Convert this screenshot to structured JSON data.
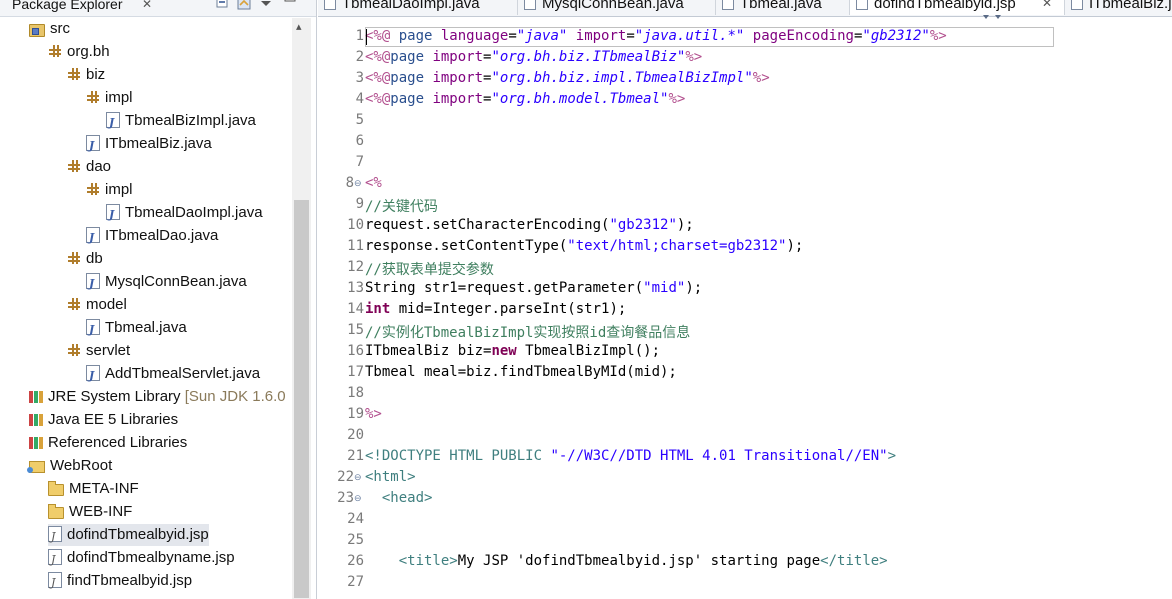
{
  "package_explorer": {
    "title": "Package Explorer",
    "close_glyph": "✕",
    "scroll_up_glyph": "▴",
    "tree": [
      {
        "label": "src",
        "icon": "source-folder-icon",
        "indent": 0
      },
      {
        "label": "org.bh",
        "icon": "package-icon",
        "indent": 1
      },
      {
        "label": "biz",
        "icon": "package-icon",
        "indent": 2
      },
      {
        "label": "impl",
        "icon": "package-icon",
        "indent": 3
      },
      {
        "label": "TbmealBizImpl.java",
        "icon": "java-file-icon",
        "indent": 4
      },
      {
        "label": "ITbmealBiz.java",
        "icon": "java-file-icon",
        "indent": 3
      },
      {
        "label": "dao",
        "icon": "package-icon",
        "indent": 2
      },
      {
        "label": "impl",
        "icon": "package-icon",
        "indent": 3
      },
      {
        "label": "TbmealDaoImpl.java",
        "icon": "java-file-icon",
        "indent": 4
      },
      {
        "label": "ITbmealDao.java",
        "icon": "java-file-icon",
        "indent": 3
      },
      {
        "label": "db",
        "icon": "package-icon",
        "indent": 2
      },
      {
        "label": "MysqlConnBean.java",
        "icon": "java-file-icon",
        "indent": 3
      },
      {
        "label": "model",
        "icon": "package-icon",
        "indent": 2
      },
      {
        "label": "Tbmeal.java",
        "icon": "java-file-icon",
        "indent": 3
      },
      {
        "label": "servlet",
        "icon": "package-icon",
        "indent": 2
      },
      {
        "label": "AddTbmealServlet.java",
        "icon": "java-file-icon",
        "indent": 3
      },
      {
        "label": "JRE System Library",
        "decoration": "[Sun JDK 1.6.0",
        "icon": "library-icon",
        "indent": 0
      },
      {
        "label": "Java EE 5 Libraries",
        "icon": "library-icon",
        "indent": 0
      },
      {
        "label": "Referenced Libraries",
        "icon": "library-icon",
        "indent": 0
      },
      {
        "label": "WebRoot",
        "icon": "web-root-folder-icon",
        "indent": 0
      },
      {
        "label": "META-INF",
        "icon": "folder-icon",
        "indent": 1
      },
      {
        "label": "WEB-INF",
        "icon": "folder-icon",
        "indent": 1
      },
      {
        "label": "dofindTbmealbyid.jsp",
        "icon": "jsp-file-icon",
        "indent": 1,
        "selected": true
      },
      {
        "label": "dofindTbmealbyname.jsp",
        "icon": "jsp-file-icon",
        "indent": 1
      },
      {
        "label": "findTbmealbyid.jsp",
        "icon": "jsp-file-icon",
        "indent": 1
      }
    ]
  },
  "editor": {
    "tabs": [
      {
        "label": "TbmealDaoImpl.java",
        "active": false
      },
      {
        "label": "MysqlConnBean.java",
        "active": false
      },
      {
        "label": "Tbmeal.java",
        "active": false
      },
      {
        "label": "dofindTbmealbyid.jsp",
        "active": true,
        "close_glyph": "✕"
      },
      {
        "label": "ITbmealBiz.java",
        "active": false
      }
    ],
    "fold_glyph": "⊖",
    "lines": [
      {
        "n": "1",
        "tokens": [
          [
            "tag",
            "<%@ "
          ],
          [
            "kw",
            "page "
          ],
          [
            "attr",
            "language"
          ],
          [
            "",
            "="
          ],
          [
            "str-i",
            "\"java\""
          ],
          [
            "",
            " "
          ],
          [
            "attr",
            "import"
          ],
          [
            "",
            "="
          ],
          [
            "str-i",
            "\"java.util.*\""
          ],
          [
            "",
            " "
          ],
          [
            "attr",
            "pageEncoding"
          ],
          [
            "",
            "="
          ],
          [
            "str-i",
            "\"gb2312\""
          ],
          [
            "tag",
            "%>"
          ]
        ]
      },
      {
        "n": "2",
        "tokens": [
          [
            "tag",
            "<%@"
          ],
          [
            "kw",
            "page "
          ],
          [
            "attr",
            "import"
          ],
          [
            "",
            "="
          ],
          [
            "str-i",
            "\"org.bh.biz.ITbmealBiz\""
          ],
          [
            "tag",
            "%>"
          ]
        ]
      },
      {
        "n": "3",
        "tokens": [
          [
            "tag",
            "<%@"
          ],
          [
            "kw",
            "page "
          ],
          [
            "attr",
            "import"
          ],
          [
            "",
            "="
          ],
          [
            "str-i",
            "\"org.bh.biz.impl.TbmealBizImpl\""
          ],
          [
            "tag",
            "%>"
          ]
        ]
      },
      {
        "n": "4",
        "tokens": [
          [
            "tag",
            "<%@"
          ],
          [
            "kw",
            "page "
          ],
          [
            "attr",
            "import"
          ],
          [
            "",
            "="
          ],
          [
            "str-i",
            "\"org.bh.model.Tbmeal\""
          ],
          [
            "tag",
            "%>"
          ]
        ]
      },
      {
        "n": "5",
        "tokens": []
      },
      {
        "n": "6",
        "tokens": []
      },
      {
        "n": "7",
        "tokens": []
      },
      {
        "n": "8",
        "fold": true,
        "tokens": [
          [
            "tag",
            "<%"
          ]
        ]
      },
      {
        "n": "9",
        "tokens": [
          [
            "cm",
            "//关键代码"
          ]
        ]
      },
      {
        "n": "10",
        "tokens": [
          [
            "",
            "request.setCharacterEncoding("
          ],
          [
            "str",
            "\"gb2312\""
          ],
          [
            "",
            ");"
          ]
        ]
      },
      {
        "n": "11",
        "tokens": [
          [
            "",
            "response.setContentType("
          ],
          [
            "str",
            "\"text/html;charset=gb2312\""
          ],
          [
            "",
            ");"
          ]
        ]
      },
      {
        "n": "12",
        "tokens": [
          [
            "cm",
            "//获取表单提交参数"
          ]
        ]
      },
      {
        "n": "13",
        "tokens": [
          [
            "",
            "String str1=request.getParameter("
          ],
          [
            "str",
            "\"mid\""
          ],
          [
            "",
            ");"
          ]
        ]
      },
      {
        "n": "14",
        "tokens": [
          [
            "jkw",
            "int"
          ],
          [
            "",
            " mid=Integer.parseInt(str1);"
          ]
        ]
      },
      {
        "n": "15",
        "tokens": [
          [
            "cm",
            "//实例化TbmealBizImpl实现按照id查询餐品信息"
          ]
        ]
      },
      {
        "n": "16",
        "tokens": [
          [
            "",
            "ITbmealBiz biz="
          ],
          [
            "jkw",
            "new"
          ],
          [
            "",
            " TbmealBizImpl();"
          ]
        ]
      },
      {
        "n": "17",
        "tokens": [
          [
            "",
            "Tbmeal meal=biz.findTbmealByMId(mid);"
          ]
        ]
      },
      {
        "n": "18",
        "tokens": []
      },
      {
        "n": "19",
        "tokens": [
          [
            "tag",
            "%>"
          ]
        ]
      },
      {
        "n": "20",
        "tokens": []
      },
      {
        "n": "21",
        "tokens": [
          [
            "html",
            "<!DOCTYPE HTML PUBLIC "
          ],
          [
            "dstr",
            "\"-//W3C//DTD HTML 4.01 Transitional//EN\""
          ],
          [
            "html",
            ">"
          ]
        ]
      },
      {
        "n": "22",
        "fold": true,
        "tokens": [
          [
            "html",
            "<html>"
          ]
        ]
      },
      {
        "n": "23",
        "fold": true,
        "tokens": [
          [
            "",
            "  "
          ],
          [
            "html",
            "<head>"
          ]
        ]
      },
      {
        "n": "24",
        "tokens": []
      },
      {
        "n": "25",
        "tokens": []
      },
      {
        "n": "26",
        "tokens": [
          [
            "",
            "    "
          ],
          [
            "html",
            "<title>"
          ],
          [
            "",
            "My JSP 'dofindTbmealbyid.jsp' starting page"
          ],
          [
            "html",
            "</title>"
          ]
        ]
      },
      {
        "n": "27",
        "tokens": []
      }
    ]
  },
  "colors": {
    "jsp_tag": "#b24f8e",
    "keyword": "#2a4f8e",
    "attribute": "#7f007f",
    "string": "#2a00ff",
    "comment": "#3f7f5f",
    "java_keyword": "#7f0055",
    "html_tag": "#3f7f7f",
    "selection": "#e3e6ec"
  }
}
